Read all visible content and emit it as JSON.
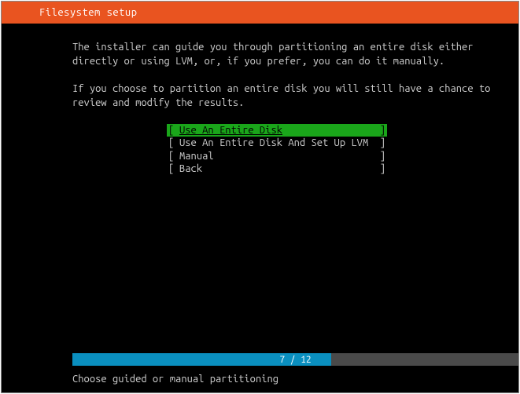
{
  "header": {
    "title": "Filesystem setup"
  },
  "body": {
    "para1": "The installer can guide you through partitioning an entire disk either directly or using LVM, or, if you prefer, you can do it manually.",
    "para2": "If you choose to partition an entire disk you will still have a chance to review and modify the results."
  },
  "menu": {
    "items": [
      {
        "label": "Use An Entire Disk",
        "selected": true
      },
      {
        "label": "Use An Entire Disk And Set Up LVM",
        "selected": false
      },
      {
        "label": "Manual",
        "selected": false
      },
      {
        "label": "Back",
        "selected": false
      }
    ]
  },
  "progress": {
    "current": 7,
    "total": 12,
    "text": "7 / 12",
    "percent": 58
  },
  "footer": {
    "hint": "Choose guided or manual partitioning"
  }
}
